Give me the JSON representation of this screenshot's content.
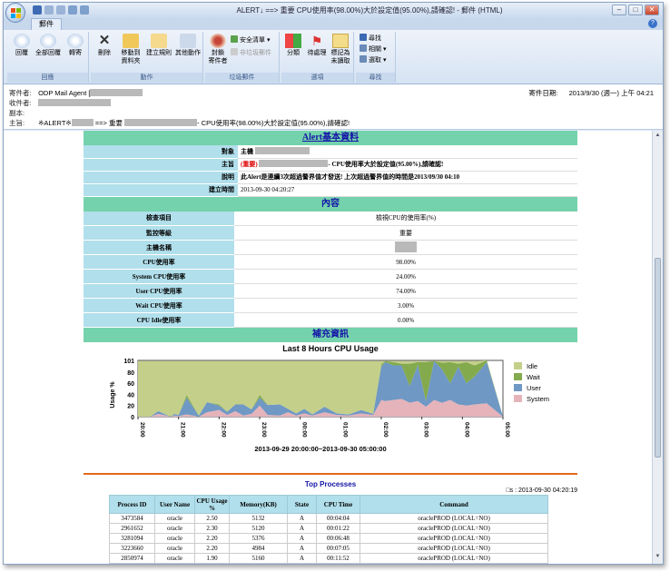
{
  "window": {
    "title": "ALERT↓          ==> 重要          CPU使用率(98.00%)大於設定值(95.00%),請確認! - 郵件 (HTML)",
    "tab": "郵件"
  },
  "ribbon": {
    "groups": [
      {
        "caption": "回應"
      },
      {
        "caption": "動作"
      },
      {
        "caption": "垃圾郵件"
      },
      {
        "caption": "選項"
      },
      {
        "caption": "尋找"
      }
    ],
    "reply": "回覆",
    "reply_all": "全部回覆",
    "forward": "轉寄",
    "delete": "刪除",
    "move_folder_1": "移動到",
    "move_folder_2": "資料夾",
    "create_rule": "建立規則",
    "other_actions_1": "其他動作",
    "block_sender_1": "封鎖",
    "block_sender_2": "寄件者",
    "safe_list": "安全清單",
    "not_junk": "非垃圾郵件",
    "categorize": "分類",
    "follow_up": "待處理",
    "mark_unread_1": "標記為",
    "mark_unread_2": "未讀取",
    "find": "尋找",
    "related": "相關",
    "select": "選取"
  },
  "header": {
    "from_label": "寄件者:",
    "from_value": "ODP Mail Agent [",
    "sent_label": "寄件日期:",
    "sent_value": "2013/9/30 (週一) 上午 04:21",
    "to_label": "收件者:",
    "cc_label": "副本:",
    "subject_label": "主旨:",
    "subject_prefix": "※ALERT※",
    "subject_mid": "==> 重要",
    "subject_tail": "- CPU使用率(98.00%)大於設定值(95.00%),請確認!"
  },
  "alert": {
    "section_title": "Alert基本資料",
    "rows": [
      {
        "key": "對象",
        "value": "主機"
      },
      {
        "key": "主旨",
        "value_red": "(重要)",
        "value": "- CPU使用率大於設定值(95.00%),請確認!"
      },
      {
        "key": "說明",
        "value": "此Alert是連續3次超過警界值才發送! 上次超過警界值的時間是2013/09/30 04:10"
      },
      {
        "key": "建立時間",
        "value": "2013-09-30 04:20:27"
      }
    ]
  },
  "content": {
    "section_title": "內容",
    "rows": [
      {
        "key": "檢查項目",
        "value": "檢視CPU的使用率(%)"
      },
      {
        "key": "監控等級",
        "value": "重要"
      },
      {
        "key": "主機名稱",
        "value": ""
      },
      {
        "key": "CPU使用率",
        "value": "98.00%"
      },
      {
        "key": "System CPU使用率",
        "value": "24.00%"
      },
      {
        "key": "User CPU使用率",
        "value": "74.00%"
      },
      {
        "key": "Wait CPU使用率",
        "value": "3.00%"
      },
      {
        "key": "CPU Idle使用率",
        "value": "0.00%"
      }
    ]
  },
  "supplement": {
    "section_title": "補充資訊"
  },
  "chart_data": {
    "type": "area",
    "title": "Last 8 Hours CPU Usage",
    "xlabel": "2013-09-29 20:00:00~2013-09-30 05:00:00",
    "ylabel": "Usage %",
    "ylim": [
      0,
      101
    ],
    "yticks": [
      "0",
      "20",
      "40",
      "60",
      "80",
      "101"
    ],
    "xticks": [
      "20:00",
      "21:00",
      "22:00",
      "23:00",
      "00:00",
      "01:00",
      "02:00",
      "03:00",
      "04:00",
      "05:00"
    ],
    "legend": [
      "Idle",
      "Wait",
      "User",
      "System"
    ],
    "colors": {
      "Idle": "#c4cf8a",
      "Wait": "#84aa4e",
      "User": "#6f98c4",
      "System": "#e5b3ba"
    },
    "x": [
      0,
      0.3,
      0.5,
      0.8,
      0.9,
      1.0,
      1.2,
      1.5,
      1.7,
      2.0,
      2.2,
      2.4,
      2.6,
      2.8,
      3.0,
      3.2,
      3.5,
      3.7,
      3.9,
      4.1,
      4.3,
      4.6,
      4.9,
      5.2,
      5.5,
      5.8,
      6.0,
      6.1,
      6.3,
      6.5,
      6.7,
      6.9,
      7.1,
      7.3,
      7.5,
      7.7,
      7.9,
      8.1,
      8.3,
      8.6,
      9.0
    ],
    "series": [
      {
        "name": "System",
        "values": [
          0,
          0,
          5,
          0,
          2,
          1,
          4,
          0,
          8,
          12,
          3,
          10,
          2,
          5,
          20,
          3,
          2,
          8,
          2,
          6,
          2,
          8,
          3,
          2,
          6,
          3,
          30,
          28,
          30,
          32,
          25,
          28,
          18,
          30,
          25,
          30,
          22,
          20,
          22,
          24,
          0
        ]
      },
      {
        "name": "User",
        "values": [
          0,
          0,
          5,
          0,
          3,
          2,
          30,
          2,
          18,
          8,
          6,
          12,
          20,
          8,
          14,
          18,
          20,
          6,
          4,
          8,
          2,
          10,
          3,
          2,
          6,
          2,
          60,
          70,
          62,
          60,
          30,
          65,
          10,
          70,
          60,
          30,
          68,
          40,
          50,
          74,
          0
        ]
      },
      {
        "name": "Wait",
        "values": [
          0,
          0,
          0,
          0,
          0,
          0,
          5,
          0,
          0,
          2,
          0,
          0,
          0,
          0,
          5,
          0,
          0,
          0,
          0,
          0,
          0,
          0,
          0,
          0,
          0,
          0,
          4,
          2,
          6,
          3,
          40,
          5,
          70,
          0,
          12,
          38,
          5,
          38,
          20,
          3,
          0
        ]
      },
      {
        "name": "Idle",
        "values": [
          100,
          100,
          90,
          100,
          95,
          97,
          61,
          98,
          74,
          78,
          91,
          78,
          78,
          87,
          61,
          79,
          78,
          86,
          94,
          86,
          96,
          82,
          94,
          96,
          88,
          95,
          6,
          0,
          2,
          5,
          5,
          2,
          2,
          0,
          3,
          2,
          5,
          2,
          8,
          0,
          0
        ]
      }
    ]
  },
  "top_processes": {
    "title": "Top Processes",
    "date": "□s : 2013-09-30 04:20:19",
    "columns": [
      "Process ID",
      "User Name",
      "CPU Usage %",
      "Memory(KB)",
      "State",
      "CPU Time",
      "Command"
    ],
    "rows": [
      [
        "3473584",
        "oracle",
        "2.50",
        "5132",
        "A",
        "00:04:04",
        "oraclePROD (LOCAL=NO)"
      ],
      [
        "2961652",
        "oracle",
        "2.30",
        "5120",
        "A",
        "00:01:22",
        "oraclePROD (LOCAL=NO)"
      ],
      [
        "3281094",
        "oracle",
        "2.20",
        "5376",
        "A",
        "00:06:48",
        "oraclePROD (LOCAL=NO)"
      ],
      [
        "3223660",
        "oracle",
        "2.20",
        "4984",
        "A",
        "00:07:05",
        "oraclePROD (LOCAL=NO)"
      ],
      [
        "2850974",
        "oracle",
        "1.90",
        "5160",
        "A",
        "00:11:52",
        "oraclePROD (LOCAL=NO)"
      ]
    ]
  }
}
